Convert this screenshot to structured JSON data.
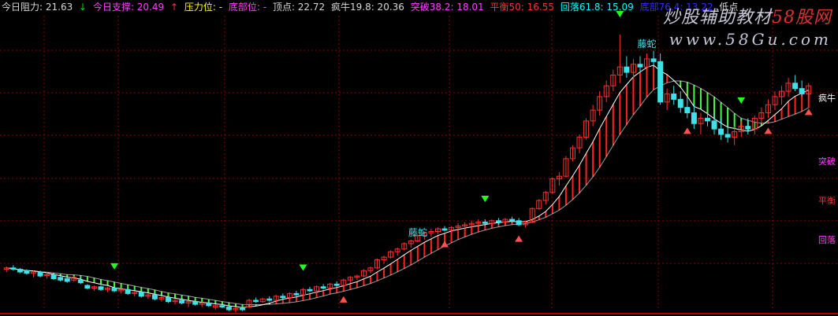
{
  "header": {
    "items": [
      {
        "label": "今日阻力: 21.63",
        "color": "#d8d8d8"
      },
      {
        "label": "↓",
        "color": "#00dd00"
      },
      {
        "label": "今日支撑: 20.49",
        "color": "#ff40ff"
      },
      {
        "label": "↑",
        "color": "#ff3030"
      },
      {
        "label": "压力位: -",
        "color": "#ffff00"
      },
      {
        "label": "底部位: -",
        "color": "#ff40ff"
      },
      {
        "label": "顶点: 22.72",
        "color": "#d8d8d8"
      },
      {
        "label": "疯牛19.8: 20.36",
        "color": "#d8d8d8"
      },
      {
        "label": "突破38.2: 18.01",
        "color": "#ff40ff"
      },
      {
        "label": "平衡50: 16.55",
        "color": "#ff3030"
      },
      {
        "label": "回落61.8: 15.09",
        "color": "#00ffff"
      },
      {
        "label": "底部76.4: 13.22",
        "color": "#3030ff"
      },
      {
        "label": "低点",
        "color": "#d8d8d8"
      }
    ]
  },
  "watermark": {
    "line1_prefix": "炒股辅助教材",
    "line1_brand": "58股网",
    "line2": "www.58Gu.com"
  },
  "colors": {
    "up": "#ff3030",
    "down": "#40e0e8",
    "grid": "#8b0000",
    "ribbon_up": "#ff2020",
    "ribbon_down": "#40ff40",
    "ribbon_neutral": "#ffff60"
  },
  "chart_data": {
    "type": "candlestick",
    "y_range": [
      12.5,
      23.4
    ],
    "levels": [
      {
        "name": "疯牛",
        "value": 20.36,
        "color": "#ffffff"
      },
      {
        "name": "突破",
        "value": 18.01,
        "color": "#ff40ff"
      },
      {
        "name": "平衡",
        "value": 16.55,
        "color": "#ff3030"
      },
      {
        "name": "回落",
        "value": 15.09,
        "color": "#ff40ff"
      }
    ],
    "annotations": [
      {
        "text": "藤蛇",
        "index": 61,
        "price": 15.0,
        "color": "#40e0e8"
      },
      {
        "text": "藤蛇",
        "index": 95,
        "price": 22.0,
        "color": "#40e0e8"
      }
    ],
    "candles": [
      [
        14.0,
        14.1,
        13.9,
        14.05
      ],
      [
        14.05,
        14.15,
        13.95,
        14.0
      ],
      [
        14.0,
        14.05,
        13.85,
        13.9
      ],
      [
        13.95,
        14.0,
        13.8,
        13.85
      ],
      [
        13.85,
        13.95,
        13.7,
        13.9
      ],
      [
        13.9,
        13.95,
        13.7,
        13.75
      ],
      [
        13.8,
        13.9,
        13.65,
        13.8
      ],
      [
        13.8,
        13.85,
        13.6,
        13.65
      ],
      [
        13.7,
        13.75,
        13.55,
        13.6
      ],
      [
        13.65,
        13.7,
        13.5,
        13.55
      ],
      [
        13.6,
        13.75,
        13.55,
        13.7
      ],
      [
        13.6,
        13.7,
        13.45,
        13.5
      ],
      [
        13.4,
        13.45,
        13.25,
        13.3
      ],
      [
        13.3,
        13.4,
        13.2,
        13.35
      ],
      [
        13.35,
        13.4,
        13.2,
        13.25
      ],
      [
        13.25,
        13.35,
        13.15,
        13.3
      ],
      [
        13.3,
        13.35,
        13.15,
        13.2
      ],
      [
        13.2,
        13.3,
        13.1,
        13.25
      ],
      [
        13.25,
        13.3,
        13.05,
        13.1
      ],
      [
        13.1,
        13.2,
        13.0,
        13.15
      ],
      [
        13.15,
        13.2,
        12.95,
        13.0
      ],
      [
        13.0,
        13.1,
        12.9,
        13.05
      ],
      [
        13.05,
        13.1,
        12.85,
        12.9
      ],
      [
        12.9,
        13.0,
        12.8,
        12.95
      ],
      [
        12.95,
        13.0,
        12.75,
        12.8
      ],
      [
        12.8,
        12.9,
        12.7,
        12.85
      ],
      [
        12.85,
        12.9,
        12.7,
        12.75
      ],
      [
        12.75,
        12.85,
        12.6,
        12.8
      ],
      [
        12.8,
        12.85,
        12.65,
        12.7
      ],
      [
        12.7,
        12.8,
        12.6,
        12.75
      ],
      [
        12.75,
        12.8,
        12.6,
        12.65
      ],
      [
        12.6,
        12.7,
        12.5,
        12.65
      ],
      [
        12.65,
        12.7,
        12.55,
        12.6
      ],
      [
        12.6,
        12.65,
        12.45,
        12.5
      ],
      [
        12.5,
        12.6,
        12.4,
        12.55
      ],
      [
        12.55,
        12.6,
        12.45,
        12.5
      ],
      [
        12.6,
        12.9,
        12.55,
        12.85
      ],
      [
        12.85,
        12.95,
        12.75,
        12.8
      ],
      [
        12.8,
        12.95,
        12.75,
        12.9
      ],
      [
        12.9,
        13.0,
        12.8,
        12.85
      ],
      [
        12.85,
        13.05,
        12.8,
        13.0
      ],
      [
        13.0,
        13.1,
        12.9,
        12.95
      ],
      [
        12.95,
        13.15,
        12.9,
        13.1
      ],
      [
        13.1,
        13.2,
        13.0,
        13.05
      ],
      [
        13.05,
        13.3,
        13.0,
        13.25
      ],
      [
        13.25,
        13.35,
        13.15,
        13.2
      ],
      [
        13.2,
        13.4,
        13.1,
        13.35
      ],
      [
        13.35,
        13.45,
        13.25,
        13.3
      ],
      [
        13.3,
        13.5,
        13.2,
        13.45
      ],
      [
        13.45,
        13.55,
        13.35,
        13.4
      ],
      [
        13.4,
        13.65,
        13.35,
        13.6
      ],
      [
        13.6,
        13.75,
        13.5,
        13.7
      ],
      [
        13.7,
        13.8,
        13.6,
        13.75
      ],
      [
        13.75,
        14.0,
        13.7,
        13.95
      ],
      [
        13.95,
        14.1,
        13.85,
        14.05
      ],
      [
        14.05,
        14.4,
        14.0,
        14.35
      ],
      [
        14.35,
        14.5,
        14.2,
        14.45
      ],
      [
        14.45,
        14.7,
        14.4,
        14.65
      ],
      [
        14.65,
        14.8,
        14.5,
        14.75
      ],
      [
        14.75,
        15.0,
        14.7,
        14.95
      ],
      [
        14.95,
        15.1,
        14.8,
        15.05
      ],
      [
        15.05,
        15.3,
        15.0,
        15.25
      ],
      [
        15.25,
        15.4,
        15.1,
        15.35
      ],
      [
        15.35,
        15.5,
        15.2,
        15.4
      ],
      [
        15.4,
        15.55,
        15.3,
        15.5
      ],
      [
        15.5,
        15.6,
        15.4,
        15.45
      ],
      [
        15.45,
        15.6,
        15.35,
        15.55
      ],
      [
        15.55,
        15.7,
        15.45,
        15.6
      ],
      [
        15.6,
        15.75,
        15.5,
        15.65
      ],
      [
        15.65,
        15.8,
        15.55,
        15.7
      ],
      [
        15.7,
        15.85,
        15.6,
        15.75
      ],
      [
        15.75,
        15.85,
        15.6,
        15.7
      ],
      [
        15.7,
        15.85,
        15.6,
        15.8
      ],
      [
        15.8,
        15.9,
        15.65,
        15.75
      ],
      [
        15.75,
        15.9,
        15.65,
        15.85
      ],
      [
        15.85,
        15.95,
        15.7,
        15.8
      ],
      [
        15.8,
        15.9,
        15.6,
        15.65
      ],
      [
        15.65,
        15.8,
        15.55,
        15.75
      ],
      [
        15.75,
        16.3,
        15.7,
        16.25
      ],
      [
        16.25,
        16.6,
        16.2,
        16.55
      ],
      [
        16.55,
        16.9,
        16.4,
        16.85
      ],
      [
        16.85,
        17.4,
        16.8,
        17.35
      ],
      [
        17.35,
        17.6,
        17.1,
        17.45
      ],
      [
        17.45,
        18.2,
        17.4,
        18.1
      ],
      [
        18.1,
        18.6,
        18.0,
        18.5
      ],
      [
        18.5,
        19.0,
        18.3,
        18.9
      ],
      [
        18.9,
        19.6,
        18.8,
        19.5
      ],
      [
        19.5,
        20.1,
        19.3,
        19.9
      ],
      [
        19.9,
        20.6,
        19.7,
        20.4
      ],
      [
        20.4,
        21.0,
        20.2,
        20.8
      ],
      [
        20.8,
        21.4,
        20.6,
        21.2
      ],
      [
        21.2,
        22.7,
        20.9,
        21.5
      ],
      [
        21.5,
        21.9,
        21.1,
        21.3
      ],
      [
        21.3,
        21.8,
        21.1,
        21.6
      ],
      [
        21.6,
        21.9,
        21.3,
        21.5
      ],
      [
        21.5,
        22.0,
        21.3,
        21.8
      ],
      [
        21.8,
        22.1,
        21.5,
        21.7
      ],
      [
        21.7,
        22.0,
        20.1,
        20.2
      ],
      [
        20.2,
        20.7,
        19.9,
        20.5
      ],
      [
        20.5,
        20.8,
        20.1,
        20.3
      ],
      [
        20.3,
        20.6,
        19.8,
        20.0
      ],
      [
        20.0,
        20.4,
        19.6,
        19.8
      ],
      [
        19.8,
        20.1,
        19.2,
        19.4
      ],
      [
        19.4,
        19.8,
        19.0,
        19.6
      ],
      [
        19.6,
        19.9,
        19.3,
        19.5
      ],
      [
        19.5,
        19.8,
        19.0,
        19.2
      ],
      [
        19.2,
        19.6,
        18.8,
        19.0
      ],
      [
        19.0,
        19.4,
        18.7,
        18.9
      ],
      [
        18.9,
        19.3,
        18.6,
        19.1
      ],
      [
        19.1,
        19.5,
        18.9,
        19.3
      ],
      [
        19.3,
        19.6,
        19.0,
        19.2
      ],
      [
        19.2,
        19.7,
        19.0,
        19.6
      ],
      [
        19.6,
        20.0,
        19.4,
        19.8
      ],
      [
        19.8,
        20.3,
        19.6,
        20.1
      ],
      [
        20.1,
        20.6,
        19.9,
        20.4
      ],
      [
        20.4,
        20.8,
        20.1,
        20.6
      ],
      [
        20.6,
        21.1,
        20.4,
        20.9
      ],
      [
        20.9,
        21.2,
        20.6,
        20.7
      ],
      [
        20.7,
        21.0,
        20.4,
        20.5
      ],
      [
        20.5,
        20.9,
        20.3,
        20.8
      ]
    ]
  }
}
